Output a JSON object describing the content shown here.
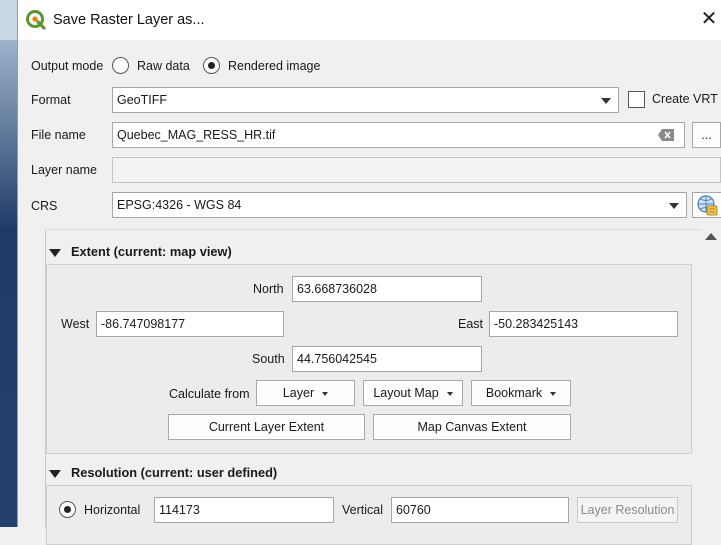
{
  "window": {
    "title": "Save Raster Layer as..."
  },
  "output_mode": {
    "label": "Output mode",
    "raw_label": "Raw data",
    "rendered_label": "Rendered image",
    "selected": "Rendered image"
  },
  "format": {
    "label": "Format",
    "value": "GeoTIFF",
    "create_vrt_label": "Create VRT",
    "create_vrt_checked": false
  },
  "file_name": {
    "label": "File name",
    "value": "Quebec_MAG_RESS_HR.tif",
    "browse_label": "..."
  },
  "layer_name": {
    "label": "Layer name",
    "value": ""
  },
  "crs": {
    "label": "CRS",
    "value": "EPSG:4326 - WGS 84"
  },
  "extent": {
    "title": "Extent (current: map view)",
    "north_label": "North",
    "north": "63.668736028",
    "west_label": "West",
    "west": "-86.747098177",
    "east_label": "East",
    "east": "-50.283425143",
    "south_label": "South",
    "south": "44.756042545",
    "calculate_from_label": "Calculate from",
    "layer_btn": "Layer",
    "layout_map_btn": "Layout Map",
    "bookmark_btn": "Bookmark",
    "current_layer_extent_btn": "Current Layer Extent",
    "map_canvas_extent_btn": "Map Canvas Extent"
  },
  "resolution": {
    "title": "Resolution (current: user defined)",
    "horizontal_label": "Horizontal",
    "horizontal": "114173",
    "vertical_label": "Vertical",
    "vertical": "60760",
    "layer_resolution_btn": "Layer Resolution"
  },
  "icons": {
    "app": "qgis-logo-icon",
    "close": "close-icon",
    "clear": "clear-text-icon",
    "crs_selector": "globe-projection-icon"
  },
  "colors": {
    "accent": "#589632",
    "window_bg": "#f0f0f0",
    "field_border": "#a6a6a6"
  }
}
